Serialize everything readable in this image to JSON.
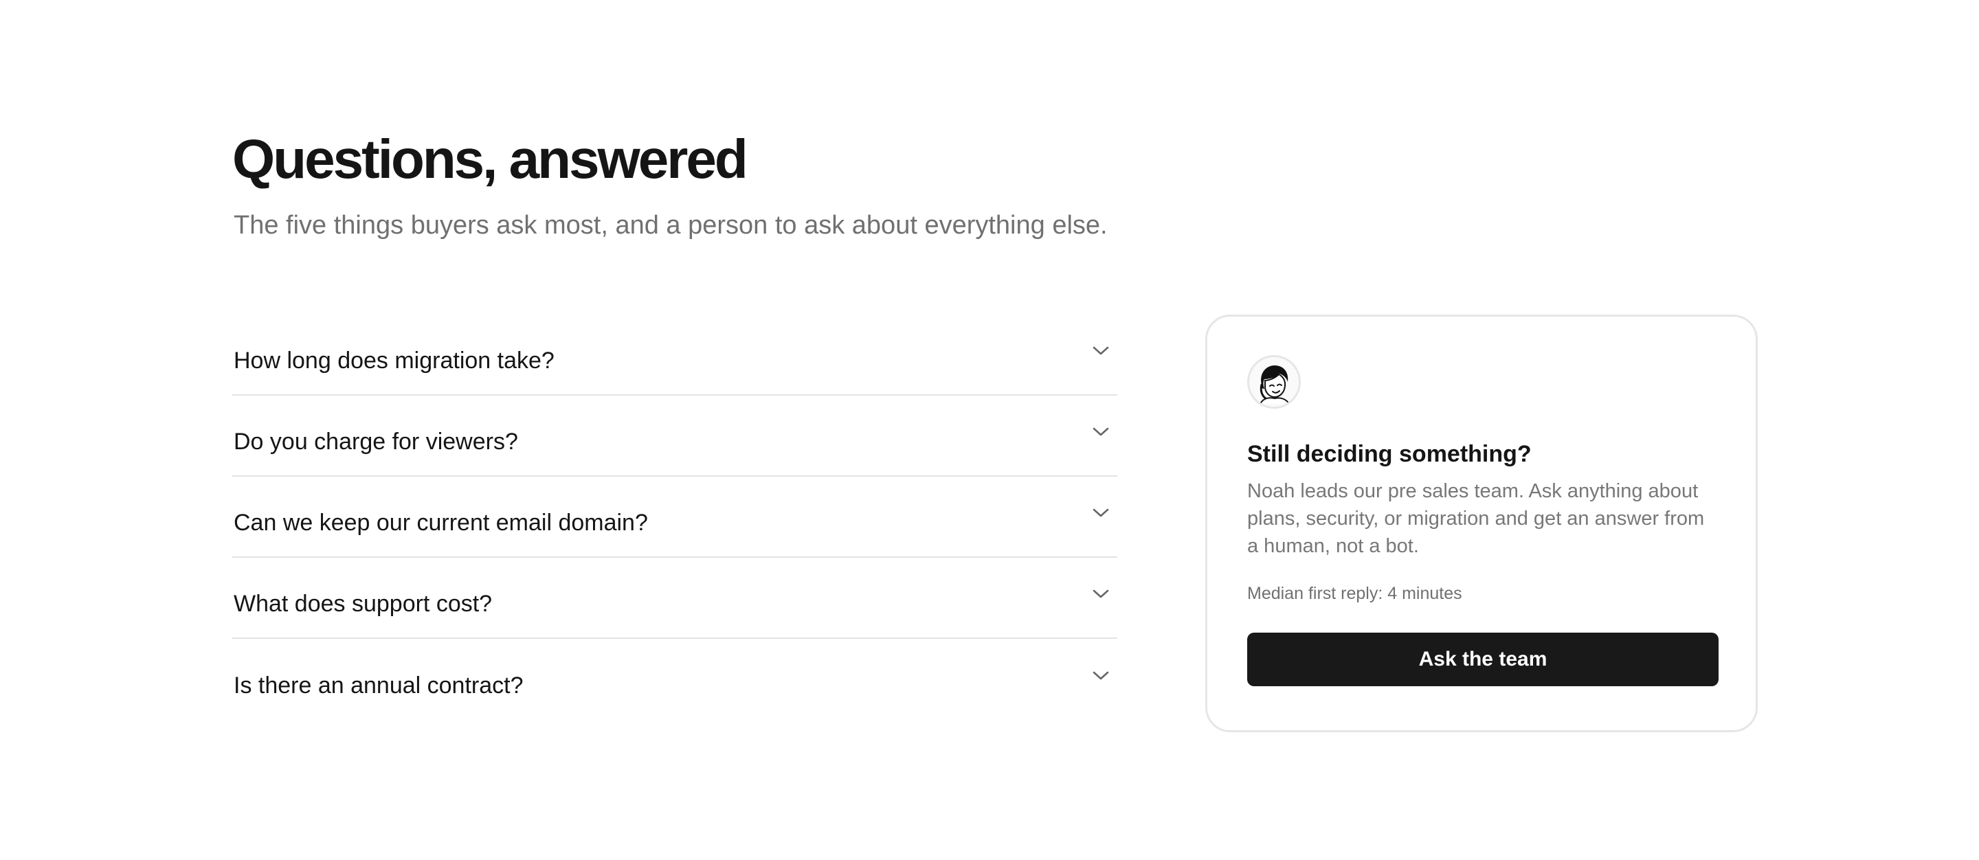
{
  "header": {
    "title": "Questions, answered",
    "subtitle": "The five things buyers ask most, and a person to ask about everything else."
  },
  "faq": {
    "items": [
      {
        "question": "How long does migration take?",
        "icon": "chevron-down-icon"
      },
      {
        "question": "Do you charge for viewers?",
        "icon": "chevron-down-icon"
      },
      {
        "question": "Can we keep our current email domain?",
        "icon": "chevron-down-icon"
      },
      {
        "question": "What does support cost?",
        "icon": "chevron-down-icon"
      },
      {
        "question": "Is there an annual contract?",
        "icon": "chevron-down-icon"
      }
    ]
  },
  "contact_card": {
    "avatar": "avatar-illustration",
    "title": "Still deciding something?",
    "body": "Noah leads our pre sales team. Ask anything about plans, security, or migration and get an answer from a human, not a bot.",
    "meta": "Median first reply: 4 minutes",
    "button_label": "Ask the team"
  },
  "colors": {
    "text": "#151515",
    "muted": "#707070",
    "divider": "#e3e3e3",
    "button_bg": "#191919",
    "button_text": "#ffffff",
    "card_border": "#e6e6e6"
  }
}
